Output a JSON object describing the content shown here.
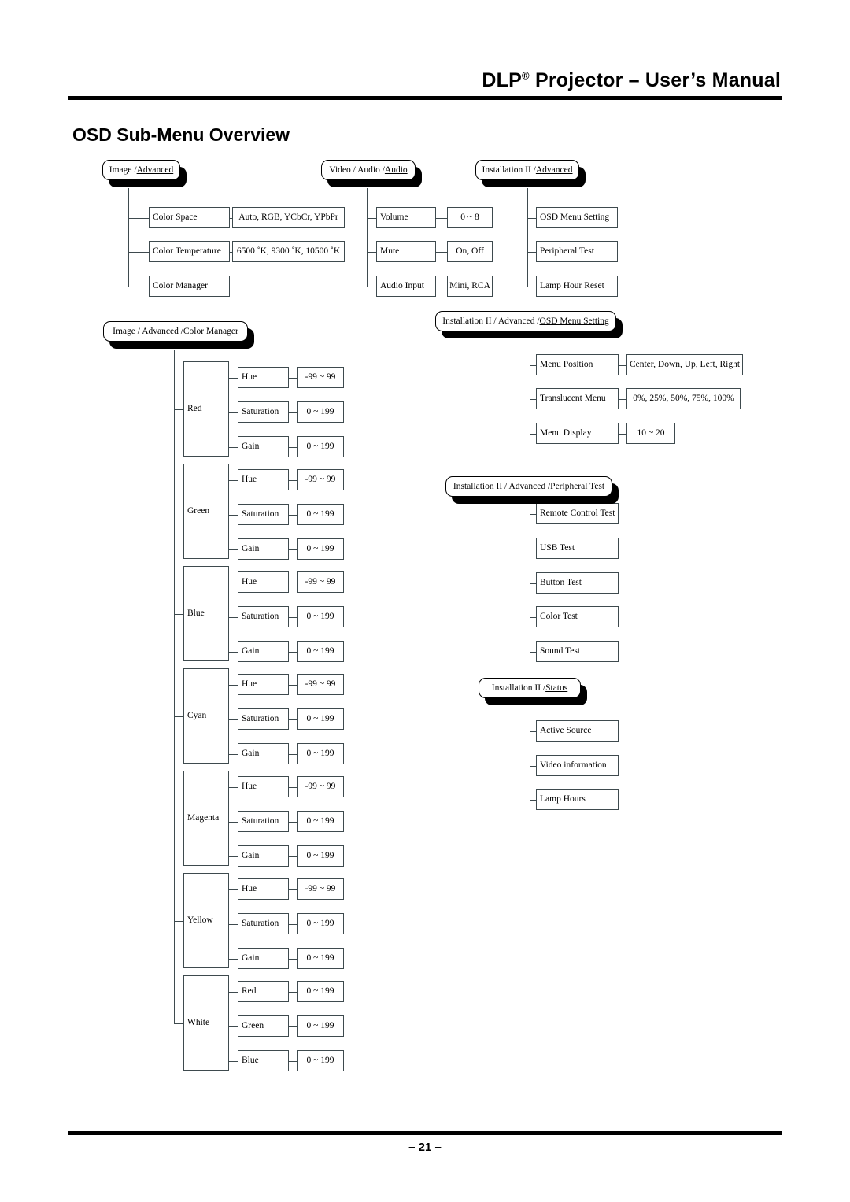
{
  "header": {
    "title_main": "DLP",
    "title_sup": "®",
    "title_rest": " Projector – User’s Manual"
  },
  "section_title": "OSD Sub-Menu Overview",
  "footer": {
    "page": "– 21 –"
  },
  "groups": [
    {
      "id": "image-advanced",
      "capsule_prefix": "Image / ",
      "capsule_underlined": "Advanced",
      "rows": [
        {
          "label": "Color Space",
          "value": "Auto, RGB, YCbCr, YPbPr"
        },
        {
          "label": "Color Temperature",
          "value": "6500 ˚K, 9300 ˚K, 10500 ˚K"
        },
        {
          "label": "Color Manager",
          "value": ""
        }
      ]
    },
    {
      "id": "video-audio-audio",
      "capsule_prefix": "Video / Audio / ",
      "capsule_underlined": "Audio",
      "rows": [
        {
          "label": "Volume",
          "value": "0 ~ 8"
        },
        {
          "label": "Mute",
          "value": "On, Off"
        },
        {
          "label": "Audio Input",
          "value": "Mini, RCA"
        }
      ]
    },
    {
      "id": "installation2-advanced",
      "capsule_prefix": "Installation II / ",
      "capsule_underlined": "Advanced",
      "rows": [
        {
          "label": "OSD Menu Setting",
          "value": ""
        },
        {
          "label": "Peripheral Test",
          "value": ""
        },
        {
          "label": "Lamp Hour Reset",
          "value": ""
        }
      ]
    },
    {
      "id": "osd-menu-setting",
      "capsule_prefix": "Installation II / Advanced / ",
      "capsule_underlined": "OSD Menu Setting",
      "rows": [
        {
          "label": "Menu Position",
          "value": "Center, Down, Up, Left, Right"
        },
        {
          "label": "Translucent Menu",
          "value": "0%, 25%, 50%, 75%, 100%"
        },
        {
          "label": "Menu Display",
          "value": "10 ~ 20"
        }
      ]
    },
    {
      "id": "peripheral-test",
      "capsule_prefix": "Installation II / Advanced / ",
      "capsule_underlined": "Peripheral Test",
      "rows": [
        {
          "label": "Remote Control Test",
          "value": ""
        },
        {
          "label": "USB Test",
          "value": ""
        },
        {
          "label": "Button Test",
          "value": ""
        },
        {
          "label": "Color Test",
          "value": ""
        },
        {
          "label": "Sound Test",
          "value": ""
        }
      ]
    },
    {
      "id": "installation2-status",
      "capsule_prefix": "Installation II / ",
      "capsule_underlined": "Status",
      "rows": [
        {
          "label": "Active Source",
          "value": ""
        },
        {
          "label": "Video information",
          "value": ""
        },
        {
          "label": "Lamp Hours",
          "value": ""
        }
      ]
    }
  ],
  "color_manager": {
    "capsule_prefix": "Image / Advanced / ",
    "capsule_underlined": "Color Manager",
    "colors": [
      {
        "name": "Red",
        "items": [
          {
            "label": "Hue",
            "value": "-99 ~ 99"
          },
          {
            "label": "Saturation",
            "value": "0 ~ 199"
          },
          {
            "label": "Gain",
            "value": "0 ~ 199"
          }
        ]
      },
      {
        "name": "Green",
        "items": [
          {
            "label": "Hue",
            "value": "-99 ~ 99"
          },
          {
            "label": "Saturation",
            "value": "0 ~ 199"
          },
          {
            "label": "Gain",
            "value": "0 ~ 199"
          }
        ]
      },
      {
        "name": "Blue",
        "items": [
          {
            "label": "Hue",
            "value": "-99 ~ 99"
          },
          {
            "label": "Saturation",
            "value": "0 ~ 199"
          },
          {
            "label": "Gain",
            "value": "0 ~ 199"
          }
        ]
      },
      {
        "name": "Cyan",
        "items": [
          {
            "label": "Hue",
            "value": "-99 ~ 99"
          },
          {
            "label": "Saturation",
            "value": "0 ~ 199"
          },
          {
            "label": "Gain",
            "value": "0 ~ 199"
          }
        ]
      },
      {
        "name": "Magenta",
        "items": [
          {
            "label": "Hue",
            "value": "-99 ~ 99"
          },
          {
            "label": "Saturation",
            "value": "0 ~ 199"
          },
          {
            "label": "Gain",
            "value": "0 ~ 199"
          }
        ]
      },
      {
        "name": "Yellow",
        "items": [
          {
            "label": "Hue",
            "value": "-99 ~ 99"
          },
          {
            "label": "Saturation",
            "value": "0 ~ 199"
          },
          {
            "label": "Gain",
            "value": "0 ~ 199"
          }
        ]
      },
      {
        "name": "White",
        "items": [
          {
            "label": "Red",
            "value": "0 ~ 199"
          },
          {
            "label": "Green",
            "value": "0 ~ 199"
          },
          {
            "label": "Blue",
            "value": "0 ~ 199"
          }
        ]
      }
    ]
  }
}
